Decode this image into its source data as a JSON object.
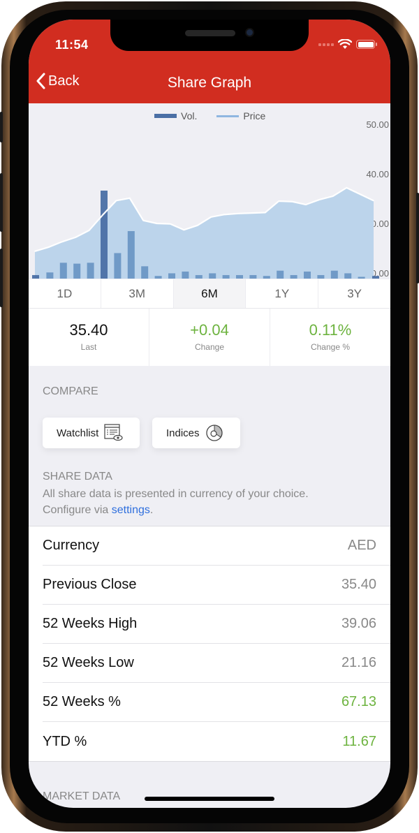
{
  "status_bar": {
    "time": "11:54"
  },
  "nav": {
    "back_label": "Back",
    "title": "Share Graph"
  },
  "chart_data": {
    "type": "bar+area",
    "title": "",
    "legend": [
      {
        "name": "Vol.",
        "color": "#4a6fa5"
      },
      {
        "name": "Price",
        "color": "#8fb6e0"
      }
    ],
    "legend_position": "top-center",
    "y_axis": {
      "ticks": [
        "50.00",
        "40.00",
        "30.00",
        "20.00"
      ],
      "ylim": [
        20,
        50
      ],
      "position": "right"
    },
    "price": [
      24.4,
      25.2,
      26.3,
      27.2,
      28.6,
      31.7,
      34.6,
      35.1,
      30.6,
      30.0,
      29.9,
      28.7,
      29.6,
      31.3,
      31.8,
      32.0,
      32.1,
      32.2,
      34.5,
      34.4,
      33.8,
      34.8,
      35.5,
      37.2,
      35.9,
      34.6
    ],
    "volume_relative": [
      4,
      7,
      18,
      17,
      18,
      100,
      29,
      54,
      14,
      3,
      6,
      8,
      4,
      6,
      4,
      4,
      4,
      3,
      9,
      4,
      8,
      4,
      9,
      6,
      2,
      3
    ]
  },
  "range_tabs": [
    {
      "label": "1D",
      "active": false
    },
    {
      "label": "3M",
      "active": false
    },
    {
      "label": "6M",
      "active": true
    },
    {
      "label": "1Y",
      "active": false
    },
    {
      "label": "3Y",
      "active": false
    }
  ],
  "stats": [
    {
      "value": "35.40",
      "label": "Last",
      "positive": false
    },
    {
      "value": "+0.04",
      "label": "Change",
      "positive": true
    },
    {
      "value": "0.11%",
      "label": "Change %",
      "positive": true
    }
  ],
  "compare": {
    "title": "COMPARE",
    "watchlist_label": "Watchlist",
    "indices_label": "Indices"
  },
  "share_data": {
    "title": "SHARE DATA",
    "description_line1": "All share data is presented in currency of your choice.",
    "description_prefix": "Configure via ",
    "settings_link": "settings",
    "description_suffix": ".",
    "rows": [
      {
        "label": "Currency",
        "value": "AED",
        "positive": false
      },
      {
        "label": "Previous Close",
        "value": "35.40",
        "positive": false
      },
      {
        "label": "52 Weeks High",
        "value": "39.06",
        "positive": false
      },
      {
        "label": "52 Weeks Low",
        "value": "21.16",
        "positive": false
      },
      {
        "label": "52 Weeks %",
        "value": "67.13",
        "positive": true
      },
      {
        "label": "YTD %",
        "value": "11.67",
        "positive": true
      }
    ]
  },
  "market_data": {
    "title": "MARKET DATA"
  },
  "colors": {
    "header": "#d12d20",
    "positive": "#6db33f",
    "link": "#2f6fdd",
    "volume_bar": "#6b97c5",
    "volume_bar_highlight": "#4a6fa5",
    "price_fill": "#bcd4eb"
  }
}
